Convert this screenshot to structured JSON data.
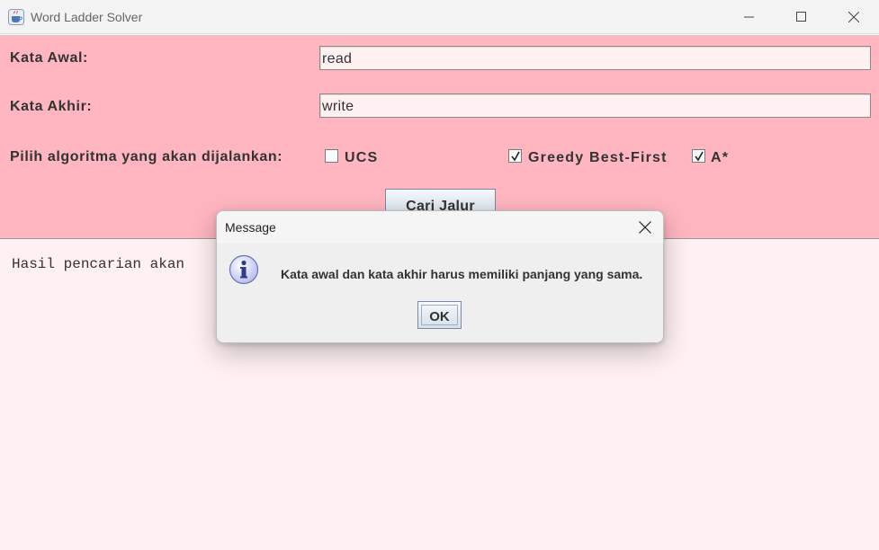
{
  "window": {
    "title": "Word Ladder Solver"
  },
  "form": {
    "start_word_label": "Kata Awal:",
    "start_word_value": "read",
    "end_word_label": "Kata Akhir:",
    "end_word_value": "write",
    "algorithm_label": "Pilih algoritma yang akan dijalankan:",
    "algorithms": [
      {
        "label": "UCS",
        "checked": false
      },
      {
        "label": "Greedy Best-First",
        "checked": true
      },
      {
        "label": "A*",
        "checked": true
      }
    ],
    "search_button_label": "Cari Jalur"
  },
  "output": {
    "text": "Hasil pencarian akan"
  },
  "dialog": {
    "title": "Message",
    "message": "Kata awal dan kata akhir harus memiliki panjang yang sama.",
    "ok_label": "OK"
  },
  "colors": {
    "panel_background": "#ffb6c1",
    "output_background": "#fff0f3"
  }
}
